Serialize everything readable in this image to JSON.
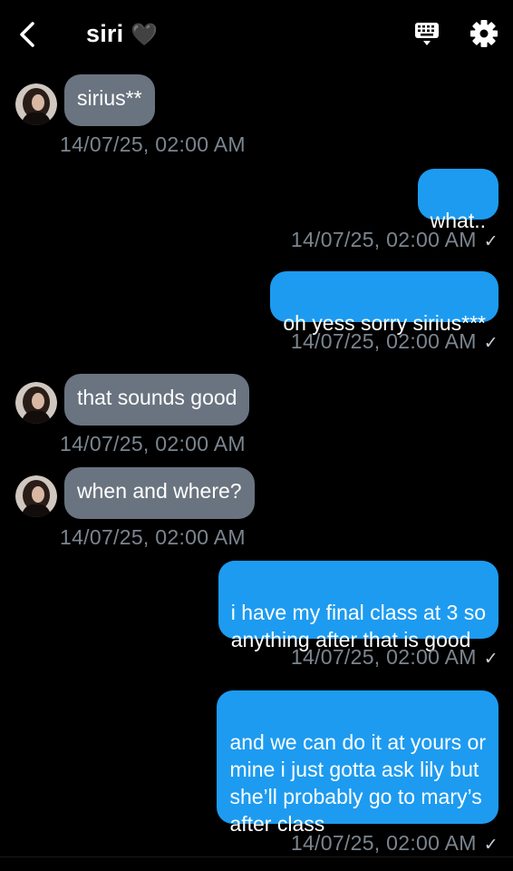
{
  "header": {
    "title": "siri",
    "title_emoji": "🖤",
    "icons": [
      "back-arrow-icon",
      "keyboard-icon",
      "gear-icon"
    ]
  },
  "messages": [
    {
      "direction": "in",
      "text": "sirius**",
      "timestamp": "14/07/25, 02:00 AM"
    },
    {
      "direction": "out",
      "text": "what..",
      "timestamp": "14/07/25, 02:00 AM",
      "read_mark": "✓"
    },
    {
      "direction": "out",
      "text": "oh yess sorry sirius***",
      "timestamp": "14/07/25, 02:00 AM",
      "read_mark": "✓"
    },
    {
      "direction": "in",
      "text": "that sounds good",
      "timestamp": "14/07/25, 02:00 AM"
    },
    {
      "direction": "in",
      "text": "when and where?",
      "timestamp": "14/07/25, 02:00 AM"
    },
    {
      "direction": "out",
      "text": "i have my final class at 3 so\nanything after that is good",
      "timestamp": "14/07/25, 02:00 AM",
      "read_mark": "✓"
    },
    {
      "direction": "out",
      "text": "and we can do it at yours or\nmine i just gotta ask lily but\nshe’ll probably go to mary’s\nafter class",
      "timestamp": "14/07/25, 02:00 AM",
      "read_mark": "✓"
    }
  ],
  "colors": {
    "background": "#000000",
    "incoming_bubble": "#6a7480",
    "outgoing_bubble": "#1d9bf0",
    "timestamp": "#7b858f"
  }
}
